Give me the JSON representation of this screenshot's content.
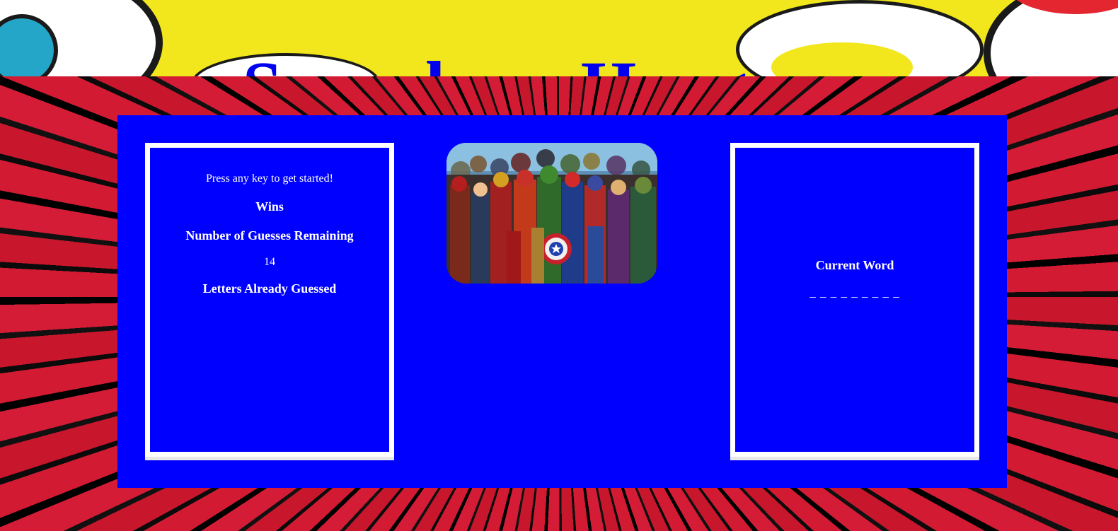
{
  "header": {
    "title": "Superhero Hangman"
  },
  "stats": {
    "intro": "Press any key to get started!",
    "wins_label": "Wins",
    "guesses_label": "Number of Guesses Remaining",
    "guesses_value": "14",
    "letters_label": "Letters Already Guessed"
  },
  "word": {
    "label": "Current Word",
    "blanks": "_ _ _ _ _ _ _ _ _"
  },
  "colors": {
    "banner": "#f1e71c",
    "title": "#0000ee",
    "panel": "#0000ff",
    "burst_red": "#d21a32"
  },
  "hero_image": {
    "icon": "superhero-group-image"
  }
}
